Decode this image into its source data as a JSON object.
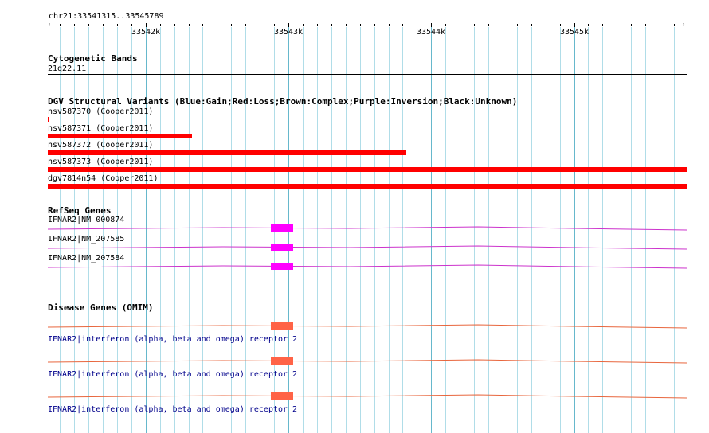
{
  "ruler": {
    "locus": "chr21:33541315..33545789",
    "start": 33541315,
    "end": 33545789,
    "ticks": [
      "33542k",
      "33543k",
      "33544k",
      "33545k"
    ]
  },
  "cytoband": {
    "title": "Cytogenetic Bands",
    "band": "21q22.11"
  },
  "dgv": {
    "title": "DGV Structural Variants (Blue:Gain;Red:Loss;Brown:Complex;Purple:Inversion;Black:Unknown)",
    "color": "#ff0000",
    "items": [
      {
        "label": "nsv587370 (Cooper2011)",
        "start": 33541315,
        "end": 33541325
      },
      {
        "label": "nsv587371 (Cooper2011)",
        "start": 33541315,
        "end": 33542325
      },
      {
        "label": "nsv587372 (Cooper2011)",
        "start": 33541315,
        "end": 33543825
      },
      {
        "label": "nsv587373 (Cooper2011)",
        "start": 33541315,
        "end": 33545789
      },
      {
        "label": "dgv7814n54 (Cooper2011)",
        "start": 33541315,
        "end": 33545789
      }
    ]
  },
  "refseq": {
    "title": "RefSeq Genes",
    "color": "#ff00ff",
    "line_color": "#cc33cc",
    "items": [
      {
        "label": "IFNAR2|NM_000874",
        "exon_start": 33542875,
        "exon_end": 33543030
      },
      {
        "label": "IFNAR2|NM_207585",
        "exon_start": 33542875,
        "exon_end": 33543030
      },
      {
        "label": "IFNAR2|NM_207584",
        "exon_start": 33542875,
        "exon_end": 33543030
      }
    ]
  },
  "omim": {
    "title": "Disease Genes (OMIM)",
    "color": "#ff6347",
    "line_color": "#e8663d",
    "items": [
      {
        "label": "IFNAR2|interferon (alpha, beta and omega) receptor 2",
        "exon_start": 33542875,
        "exon_end": 33543030
      },
      {
        "label": "IFNAR2|interferon (alpha, beta and omega) receptor 2",
        "exon_start": 33542875,
        "exon_end": 33543030
      },
      {
        "label": "IFNAR2|interferon (alpha, beta and omega) receptor 2",
        "exon_start": 33542875,
        "exon_end": 33543030
      }
    ]
  },
  "colors": {
    "grid_minor": "#b0dde8",
    "grid_major": "#66b8cc"
  }
}
